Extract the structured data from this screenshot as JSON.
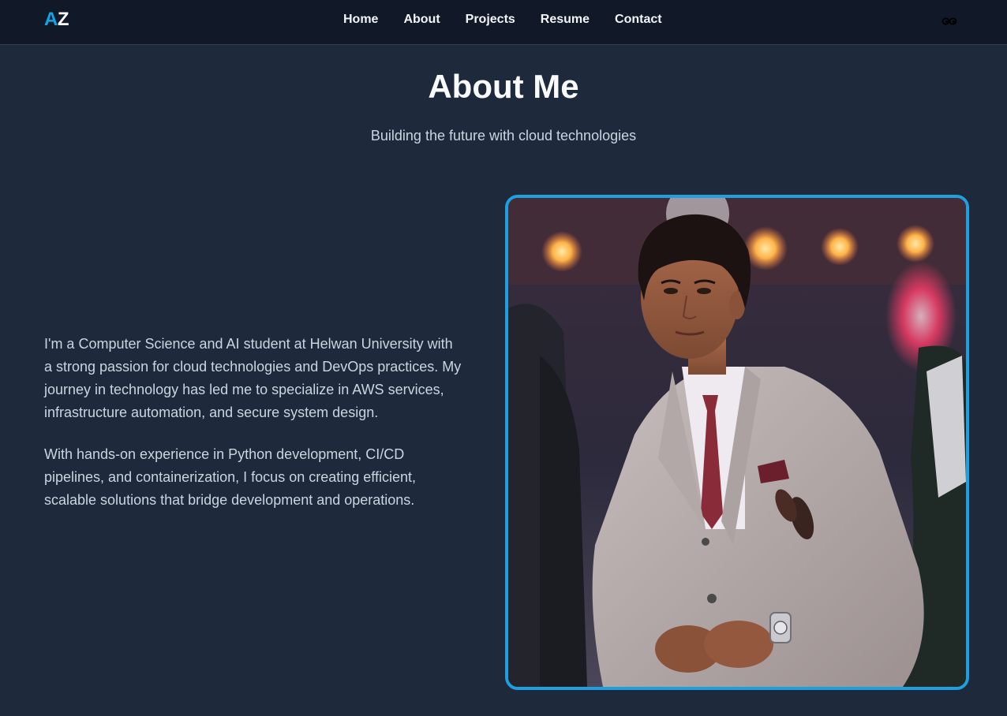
{
  "navbar": {
    "logo_a": "A",
    "logo_z": "Z",
    "links": [
      "Home",
      "About",
      "Projects",
      "Resume",
      "Contact"
    ],
    "theme_icon": "eyes-icon"
  },
  "hero": {
    "title": "About Me",
    "subtitle": "Building the future with cloud technologies"
  },
  "about": {
    "paragraphs": [
      "I'm a Computer Science and AI student at Helwan University with a strong passion for cloud technologies and DevOps practices. My journey in technology has led me to specialize in AWS services, infrastructure automation, and secure system design.",
      "With hands-on experience in Python development, CI/CD pipelines, and containerization, I focus on creating efficient, scalable solutions that bridge development and operations."
    ]
  },
  "photo": {
    "icon": "profile-photo",
    "border_color": "#1d9fe0"
  },
  "colors": {
    "accent": "#0ea5e9",
    "background": "#1e293b",
    "navbar": "#111827"
  }
}
